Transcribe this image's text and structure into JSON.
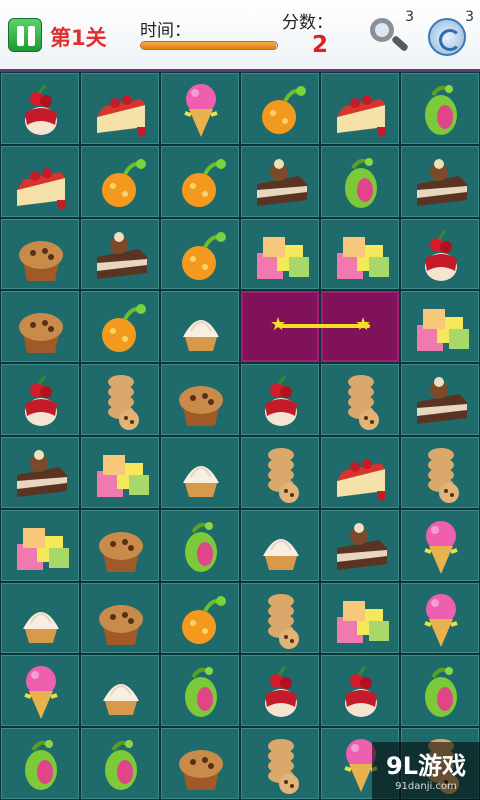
{
  "header": {
    "level": "第1关",
    "time_label": "时间：",
    "time_progress": 0.99,
    "score_label": "分数：",
    "score": "2",
    "hint_count": "3",
    "shuffle_count": "3",
    "hint_icon": "magnifier-icon",
    "shuffle_icon": "refresh-icon",
    "pause_icon": "pause-icon"
  },
  "board": {
    "rows": 10,
    "cols": 6,
    "tiles": [
      [
        "cherry-pudding",
        "cheesecake",
        "icecream-cone",
        "orange-fruit",
        "cheesecake",
        "green-pea"
      ],
      [
        "cheesecake",
        "orange-fruit",
        "orange-fruit",
        "chocolate-cake",
        "green-pea",
        "chocolate-cake"
      ],
      [
        "muffin",
        "chocolate-cake",
        "orange-fruit",
        "jelly-cubes",
        "jelly-cubes",
        "cherry-pudding"
      ],
      [
        "muffin",
        "orange-fruit",
        "cream-tart",
        "",
        "",
        "jelly-cubes"
      ],
      [
        "cherry-pudding",
        "cookie-stack",
        "muffin",
        "cherry-pudding",
        "cookie-stack",
        "chocolate-cake"
      ],
      [
        "chocolate-cake",
        "jelly-cubes",
        "cream-tart",
        "cookie-stack",
        "cheesecake",
        "cookie-stack"
      ],
      [
        "jelly-cubes",
        "muffin",
        "green-pea",
        "cream-tart",
        "chocolate-cake",
        "icecream-cone"
      ],
      [
        "cream-tart",
        "muffin",
        "orange-fruit",
        "cookie-stack",
        "jelly-cubes",
        "icecream-cone"
      ],
      [
        "icecream-cone",
        "cream-tart",
        "green-pea",
        "cherry-pudding",
        "cherry-pudding",
        "green-pea"
      ],
      [
        "green-pea",
        "green-pea",
        "muffin",
        "cookie-stack",
        "icecream-cone",
        "cookie-stack"
      ]
    ],
    "selected_cells": [
      [
        3,
        3
      ],
      [
        3,
        4
      ]
    ],
    "link_icon": "star-icon"
  },
  "watermark": {
    "brand": "9L游戏",
    "url": "91danji.com"
  },
  "colors": {
    "board_bg": "#1f6a6b",
    "selected_bg": "#80125a",
    "accent_red": "#e02020",
    "link_yellow": "#f5dd2a"
  }
}
